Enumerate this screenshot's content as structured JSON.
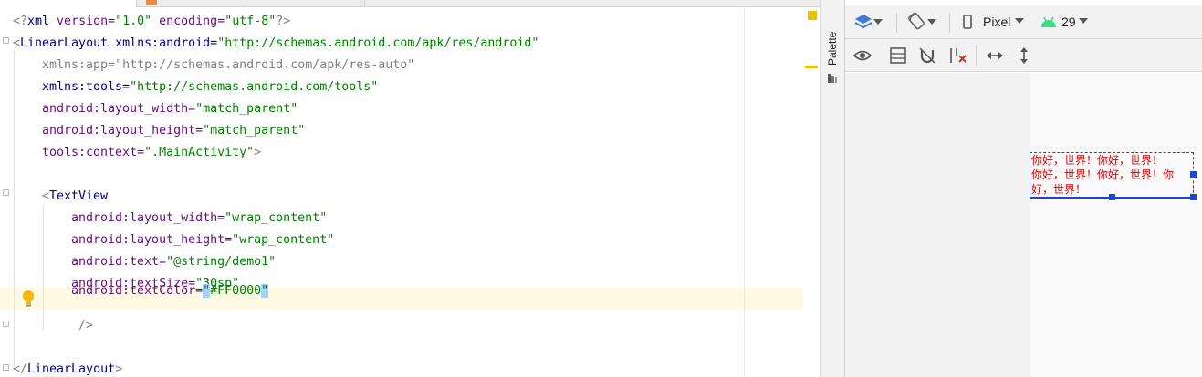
{
  "editor": {
    "lines": {
      "l1_open": "<?",
      "l1_xml": "xml",
      "l1_version_attr": " version=",
      "l1_version_val": "\"1.0\"",
      "l1_encoding_attr": " encoding=",
      "l1_encoding_val": "\"utf-8\"",
      "l1_close": "?>",
      "l2_open": "<",
      "l2_tag": "LinearLayout",
      "l2_attr": " xmlns:android=",
      "l2_val": "\"http://schemas.android.com/apk/res/android\"",
      "l3_attr": "xmlns:app=",
      "l3_val": "\"http://schemas.android.com/apk/res-auto\"",
      "l4_attr": "xmlns:tools=",
      "l4_val": "\"http://schemas.android.com/tools\"",
      "l5_attr": "android:layout_width=",
      "l5_val": "\"match_parent\"",
      "l6_attr": "android:layout_height=",
      "l6_val": "\"match_parent\"",
      "l7_attr": "tools:context=",
      "l7_val": "\".MainActivity\"",
      "l7_close": ">",
      "l9_open": "<",
      "l9_tag": "TextView",
      "l10_attr": "android:layout_width=",
      "l10_val": "\"wrap_content\"",
      "l11_attr": "android:layout_height=",
      "l11_val": "\"wrap_content\"",
      "l12_attr": "android:text=",
      "l12_val": "\"@string/demo1\"",
      "l13_attr": "android:textSize=",
      "l13_val": "\"30sp\"",
      "l14_attr": "android:textColor=",
      "l14_q1": "\"",
      "l14_val": "#FF0000",
      "l14_q2": "\"",
      "l15_close": "/>",
      "l17_open": "</",
      "l17_tag": "LinearLayout",
      "l17_close": ">"
    }
  },
  "palette": {
    "label": "Palette"
  },
  "toolbar": {
    "device_label": "Pixel",
    "api_label": "29"
  },
  "preview": {
    "text_line1": "你好，世界！你好，世界！",
    "text_line2": "你好，世界！你好，世界！你",
    "text_line3": "好，世界！"
  },
  "colors": {
    "warning": "#e8c100",
    "selection_blue": "#1a45d6",
    "text_red": "#e00000",
    "android_green": "#3ddc84"
  }
}
